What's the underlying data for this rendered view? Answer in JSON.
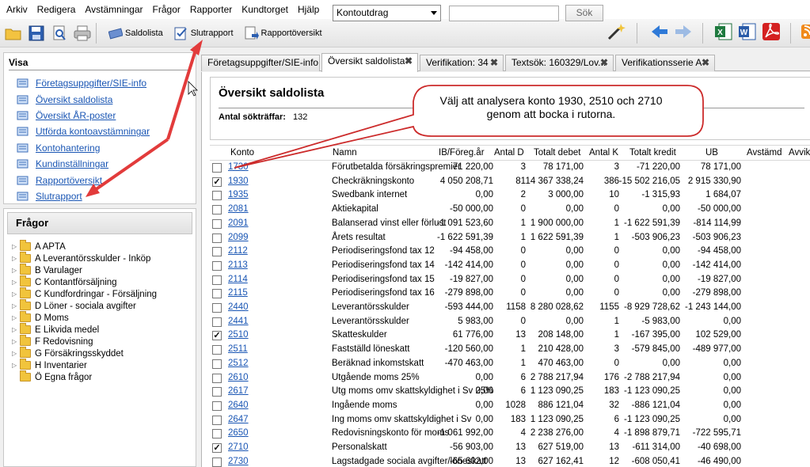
{
  "menu": [
    "Arkiv",
    "Redigera",
    "Avstämningar",
    "Frågor",
    "Rapporter",
    "Kundtorget",
    "Hjälp"
  ],
  "toolbar": {
    "buttons": [
      "Saldolista",
      "Slutrapport",
      "Rapportöversikt"
    ],
    "combo_value": "Kontoutdrag",
    "search_value": "",
    "search_button": "Sök"
  },
  "visa": {
    "title": "Visa",
    "items": [
      "Företagsuppgifter/SIE-info",
      "Översikt saldolista",
      "Översikt ÅR-poster",
      "Utförda kontoavstämningar",
      "Kontohantering",
      "Kundinställningar",
      "Rapportöversikt",
      "Slutrapport"
    ]
  },
  "fragor": {
    "title": "Frågor",
    "items": [
      "A APTA",
      "A Leverantörsskulder - Inköp",
      "B Varulager",
      "C Kontantförsäljning",
      "C Kundfordringar - Försäljning",
      "D Löner - sociala avgifter",
      "D Moms",
      "E Likvida medel",
      "F Redovisning",
      "G Försäkringsskyddet",
      "H Inventarier",
      "Ö Egna frågor"
    ]
  },
  "tabs": [
    "Företagsuppgifter/SIE-info",
    "Översikt saldolista",
    "Verifikation: 34",
    "Textsök: 160329/Lov...",
    "Verifikationsserie A"
  ],
  "main": {
    "title": "Översikt saldolista",
    "antal_label": "Antal sökträffar:",
    "antal_value": "132"
  },
  "callout": "Välj att analysera konto 1930, 2510 och 2710 genom att bocka i rutorna.",
  "table": {
    "headers": [
      "Konto",
      "Namn",
      "IB/Föreg.år",
      "Antal D",
      "Totalt debet",
      "Antal K",
      "Totalt kredit",
      "UB",
      "Avstämd",
      "Avvik"
    ],
    "rows": [
      {
        "checked": false,
        "konto": "1730",
        "namn": "Förutbetalda försäkringspremier",
        "ib": "71 220,00",
        "ad": "3",
        "td": "78 171,00",
        "ak": "3",
        "tk": "-71 220,00",
        "ub": "78 171,00"
      },
      {
        "checked": true,
        "konto": "1930",
        "namn": "Checkräkningskonto",
        "ib": "4 050 208,71",
        "ad": "81",
        "td": "14 367 338,24",
        "ak": "386",
        "tk": "-15 502 216,05",
        "ub": "2 915 330,90"
      },
      {
        "checked": false,
        "konto": "1935",
        "namn": "Swedbank internet",
        "ib": "0,00",
        "ad": "2",
        "td": "3 000,00",
        "ak": "10",
        "tk": "-1 315,93",
        "ub": "1 684,07"
      },
      {
        "checked": false,
        "konto": "2081",
        "namn": "Aktiekapital",
        "ib": "-50 000,00",
        "ad": "0",
        "td": "0,00",
        "ak": "0",
        "tk": "0,00",
        "ub": "-50 000,00"
      },
      {
        "checked": false,
        "konto": "2091",
        "namn": "Balanserad vinst eller förlust",
        "ib": "-1 091 523,60",
        "ad": "1",
        "td": "1 900 000,00",
        "ak": "1",
        "tk": "-1 622 591,39",
        "ub": "-814 114,99"
      },
      {
        "checked": false,
        "konto": "2099",
        "namn": "Årets resultat",
        "ib": "-1 622 591,39",
        "ad": "1",
        "td": "1 622 591,39",
        "ak": "1",
        "tk": "-503 906,23",
        "ub": "-503 906,23"
      },
      {
        "checked": false,
        "konto": "2112",
        "namn": "Periodiseringsfond tax 12",
        "ib": "-94 458,00",
        "ad": "0",
        "td": "0,00",
        "ak": "0",
        "tk": "0,00",
        "ub": "-94 458,00"
      },
      {
        "checked": false,
        "konto": "2113",
        "namn": "Periodiseringsfond tax 14",
        "ib": "-142 414,00",
        "ad": "0",
        "td": "0,00",
        "ak": "0",
        "tk": "0,00",
        "ub": "-142 414,00"
      },
      {
        "checked": false,
        "konto": "2114",
        "namn": "Periodiseringsfond tax 15",
        "ib": "-19 827,00",
        "ad": "0",
        "td": "0,00",
        "ak": "0",
        "tk": "0,00",
        "ub": "-19 827,00"
      },
      {
        "checked": false,
        "konto": "2115",
        "namn": "Periodiseringsfond tax 16",
        "ib": "-279 898,00",
        "ad": "0",
        "td": "0,00",
        "ak": "0",
        "tk": "0,00",
        "ub": "-279 898,00"
      },
      {
        "checked": false,
        "konto": "2440",
        "namn": "Leverantörsskulder",
        "ib": "-593 444,00",
        "ad": "1158",
        "td": "8 280 028,62",
        "ak": "1155",
        "tk": "-8 929 728,62",
        "ub": "-1 243 144,00"
      },
      {
        "checked": false,
        "konto": "2441",
        "namn": "Leverantörsskulder",
        "ib": "5 983,00",
        "ad": "0",
        "td": "0,00",
        "ak": "1",
        "tk": "-5 983,00",
        "ub": "0,00"
      },
      {
        "checked": true,
        "konto": "2510",
        "namn": "Skatteskulder",
        "ib": "61 776,00",
        "ad": "13",
        "td": "208 148,00",
        "ak": "1",
        "tk": "-167 395,00",
        "ub": "102 529,00"
      },
      {
        "checked": false,
        "konto": "2511",
        "namn": "Fastställd löneskatt",
        "ib": "-120 560,00",
        "ad": "1",
        "td": "210 428,00",
        "ak": "3",
        "tk": "-579 845,00",
        "ub": "-489 977,00"
      },
      {
        "checked": false,
        "konto": "2512",
        "namn": "Beräknad inkomstskatt",
        "ib": "-470 463,00",
        "ad": "1",
        "td": "470 463,00",
        "ak": "0",
        "tk": "0,00",
        "ub": "0,00"
      },
      {
        "checked": false,
        "konto": "2610",
        "namn": "Utgående moms 25%",
        "ib": "0,00",
        "ad": "6",
        "td": "2 788 217,94",
        "ak": "176",
        "tk": "-2 788 217,94",
        "ub": "0,00"
      },
      {
        "checked": false,
        "konto": "2617",
        "namn": "Utg moms omv skattskyldighet i Sv 25%",
        "ib": "0,00",
        "ad": "6",
        "td": "1 123 090,25",
        "ak": "183",
        "tk": "-1 123 090,25",
        "ub": "0,00"
      },
      {
        "checked": false,
        "konto": "2640",
        "namn": "Ingående moms",
        "ib": "0,00",
        "ad": "1028",
        "td": "886 121,04",
        "ak": "32",
        "tk": "-886 121,04",
        "ub": "0,00"
      },
      {
        "checked": false,
        "konto": "2647",
        "namn": "Ing moms omv skattskyldighet i Sv",
        "ib": "0,00",
        "ad": "183",
        "td": "1 123 090,25",
        "ak": "6",
        "tk": "-1 123 090,25",
        "ub": "0,00"
      },
      {
        "checked": false,
        "konto": "2650",
        "namn": "Redovisningskonto för moms",
        "ib": "-1 061 992,00",
        "ad": "4",
        "td": "2 238 276,00",
        "ak": "4",
        "tk": "-1 898 879,71",
        "ub": "-722 595,71"
      },
      {
        "checked": true,
        "konto": "2710",
        "namn": "Personalskatt",
        "ib": "-56 903,00",
        "ad": "13",
        "td": "627 519,00",
        "ak": "13",
        "tk": "-611 314,00",
        "ub": "-40 698,00"
      },
      {
        "checked": false,
        "konto": "2730",
        "namn": "Lagstadgade sociala avgifter/löneskatt",
        "ib": "-65 602,00",
        "ad": "13",
        "td": "627 162,41",
        "ak": "12",
        "tk": "-608 050,41",
        "ub": "-46 490,00"
      }
    ]
  },
  "colors": {
    "link": "#1a56b4",
    "arrow": "#e23b3b",
    "callout_border": "#cc2b2b"
  }
}
